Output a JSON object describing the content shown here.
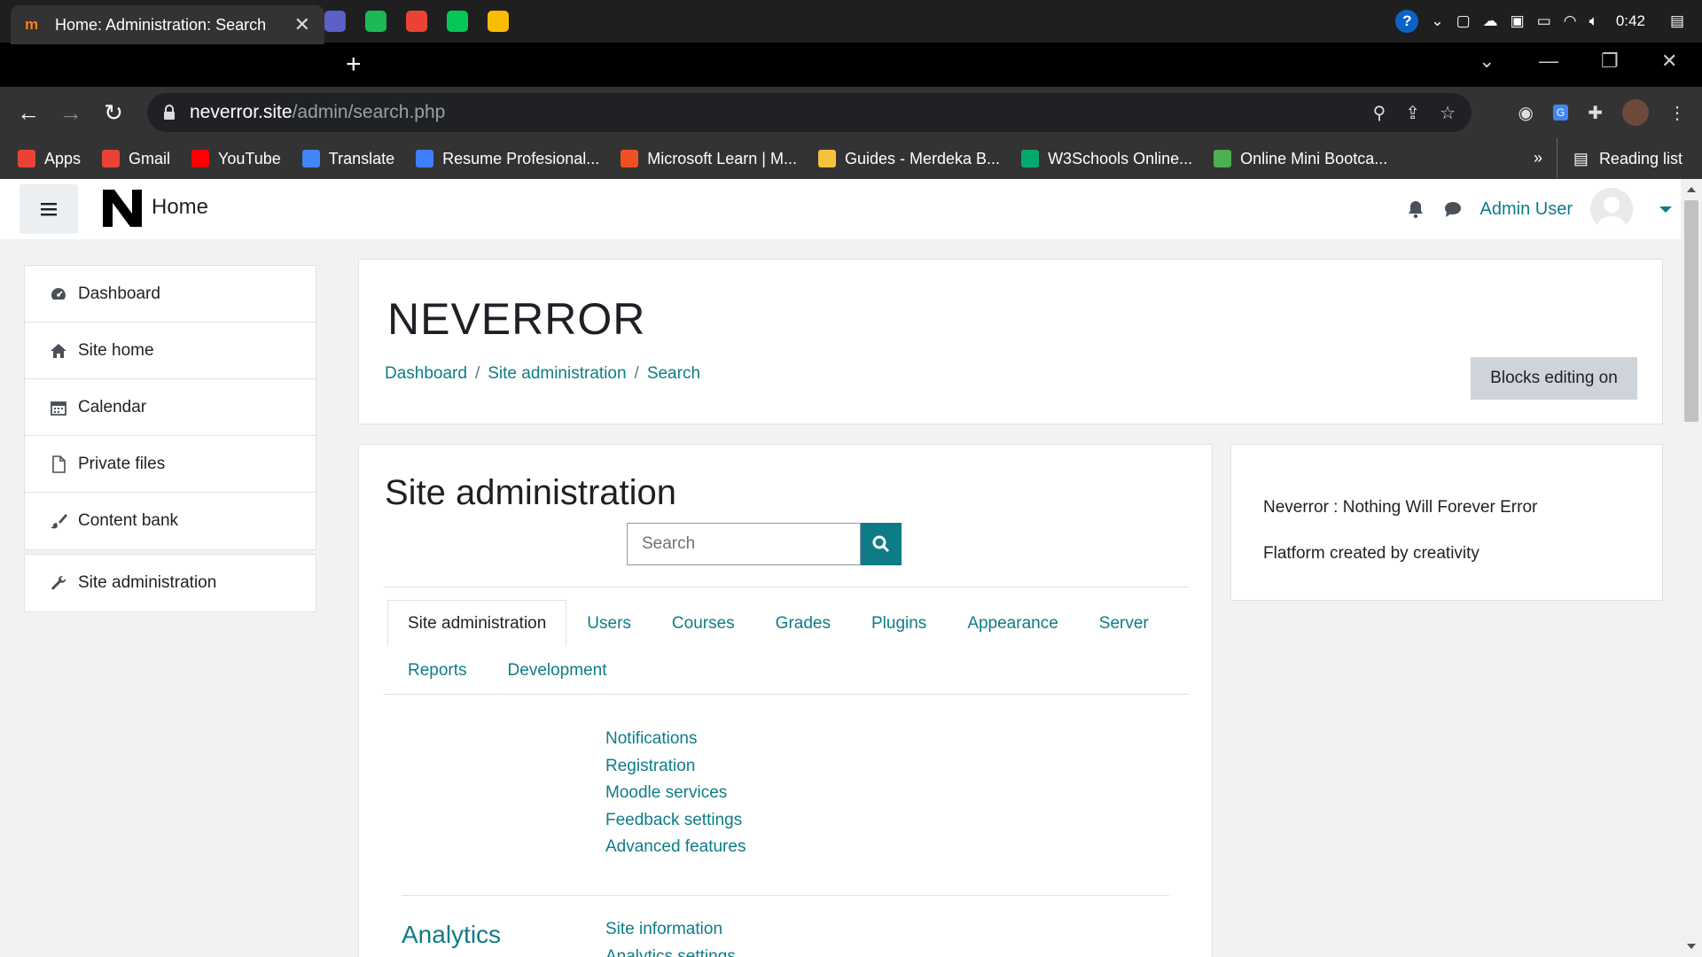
{
  "taskbar": {
    "clock": "0:42",
    "apps": [
      {
        "name": "mail-icon",
        "color": "#0a64c8"
      },
      {
        "name": "file-explorer-icon",
        "color": "#f6c23e"
      },
      {
        "name": "chrome-icon",
        "color": "#34a853"
      },
      {
        "name": "edge-icon",
        "color": "#1fa463"
      },
      {
        "name": "discord-icon",
        "color": "#5865f2"
      },
      {
        "name": "teams-icon",
        "color": "#5b5fc7"
      },
      {
        "name": "spotify-icon",
        "color": "#1db954"
      },
      {
        "name": "chrome-profile-icon",
        "color": "#ea4335"
      },
      {
        "name": "line-icon",
        "color": "#06c755"
      },
      {
        "name": "chrome-profile-2-icon",
        "color": "#fbbc05"
      }
    ]
  },
  "browser": {
    "tab_title": "Home: Administration: Search",
    "url_host": "neverror.site",
    "url_path": "/admin/search.php",
    "bookmarks": [
      {
        "label": "Apps",
        "color": "#ea4335"
      },
      {
        "label": "Gmail",
        "color": "#ea4335"
      },
      {
        "label": "YouTube",
        "color": "#ff0000"
      },
      {
        "label": "Translate",
        "color": "#4285f4"
      },
      {
        "label": "Resume Profesional...",
        "color": "#3f7fff"
      },
      {
        "label": "Microsoft Learn | M...",
        "color": "#f25022"
      },
      {
        "label": "Guides - Merdeka B...",
        "color": "#f6c23e"
      },
      {
        "label": "W3Schools Online...",
        "color": "#04aa6d"
      },
      {
        "label": "Online Mini Bootca...",
        "color": "#4caf50"
      }
    ],
    "bookmarks_more": "»",
    "reading_list": "Reading list"
  },
  "navbar": {
    "brand": "Home",
    "user_name": "Admin User"
  },
  "sidebar": {
    "items": [
      {
        "label": "Dashboard",
        "icon": "dashboard-icon"
      },
      {
        "label": "Site home",
        "icon": "home-icon"
      },
      {
        "label": "Calendar",
        "icon": "calendar-icon"
      },
      {
        "label": "Private files",
        "icon": "file-icon"
      },
      {
        "label": "Content bank",
        "icon": "brush-icon"
      }
    ],
    "admin_item": {
      "label": "Site administration",
      "icon": "wrench-icon"
    }
  },
  "header": {
    "site_name": "NEVERROR",
    "breadcrumb": [
      "Dashboard",
      "Site administration",
      "Search"
    ],
    "blocks_button": "Blocks editing on"
  },
  "admin": {
    "title": "Site administration",
    "search_placeholder": "Search",
    "tabs_row1": [
      "Site administration",
      "Users",
      "Courses",
      "Grades",
      "Plugins",
      "Appearance",
      "Server"
    ],
    "tabs_row2": [
      "Reports",
      "Development"
    ],
    "general_links": [
      "Notifications",
      "Registration",
      "Moodle services",
      "Feedback settings",
      "Advanced features"
    ],
    "analytics_title": "Analytics",
    "analytics_links": [
      "Site information",
      "Analytics settings"
    ]
  },
  "block": {
    "line1": "Neverror : Nothing Will Forever Error",
    "line2": "Flatform created by creativity"
  },
  "colors": {
    "accent": "#0e7c86",
    "sidebar_bg": "#f2f2f2"
  }
}
